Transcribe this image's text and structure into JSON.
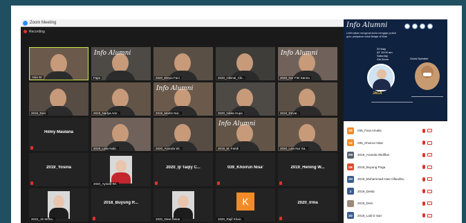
{
  "window": {
    "title": "Zoom Meeting",
    "recording_label": "Recording"
  },
  "tiles": [
    {
      "label": "Asia Sr",
      "kind": "video",
      "active": true
    },
    {
      "label": "Fajar",
      "kind": "video"
    },
    {
      "label": "2020_Eleyia Fani",
      "kind": "video"
    },
    {
      "label": "2020_Hikmal_Cle..",
      "kind": "video"
    },
    {
      "label": "2020_Nur Fitri Sanna",
      "kind": "video"
    },
    {
      "label": "2019_Desi",
      "kind": "video"
    },
    {
      "label": "2019_Nadya Amr..",
      "kind": "video"
    },
    {
      "label": "2019_Martin Nur..",
      "kind": "video"
    },
    {
      "label": "2020_Nikita Hupa",
      "kind": "video"
    },
    {
      "label": "2019_Dtrvar..",
      "kind": "video"
    },
    {
      "label": "Hilmy Maulana",
      "kind": "name"
    },
    {
      "label": "2019_Laila Nabi..",
      "kind": "video"
    },
    {
      "label": "2020_Ananda Wi..",
      "kind": "video"
    },
    {
      "label": "2019_M..Faridi",
      "kind": "video"
    },
    {
      "label": "2020_Lala Nur Sa..",
      "kind": "video"
    },
    {
      "label": "2019_Yosina",
      "kind": "name"
    },
    {
      "label": "2020_Ayinda Wi..",
      "kind": "photo"
    },
    {
      "label": "2020_Ijl Taqly C...",
      "kind": "name"
    },
    {
      "label": "039_Khoirun Nisa'",
      "kind": "name"
    },
    {
      "label": "2019_Hening W...",
      "kind": "name"
    },
    {
      "label": "2019_Jin Moha..",
      "kind": "photo"
    },
    {
      "label": "2018_Buyung R...",
      "kind": "name"
    },
    {
      "label": "2020_Dewi Sekar",
      "kind": "photo"
    },
    {
      "label": "2020_Rajif Khair..",
      "kind": "letter",
      "letter": "K"
    },
    {
      "label": "2020_Irma",
      "kind": "name"
    }
  ],
  "poster": {
    "title": "Info Alumni",
    "description": "Lebih dalam mengenal dunia mengajar profesi guru: pelayanan untuk Belajar di Kitab",
    "date": "29 May",
    "time": "AT 10:00 am",
    "day": "Saturday",
    "platform": "Via Zoom",
    "guest_label": "Guest Speaker",
    "logo_text": "JACA"
  },
  "participants": [
    {
      "initials": "03",
      "name": "035_Fara Amalia",
      "color": "#f28c28"
    },
    {
      "initials": "03",
      "name": "035_Khoirun Nisa'",
      "color": "#f28c28"
    },
    {
      "initials": "2W",
      "name": "2019_Ananda Widiflas",
      "color": "#555f6d"
    },
    {
      "initials": "2B",
      "name": "2018_Buyung Poga",
      "color": "#e0482f"
    },
    {
      "initials": "2H",
      "name": "2019_Muhammad Hasi Alfandha..",
      "color": "#3b5b8c"
    },
    {
      "initials": "2",
      "name": "2019_Desla",
      "color": "#3b5b8c"
    },
    {
      "initials": "",
      "name": "2019_Desi",
      "color": "#9b8a7a"
    },
    {
      "initials": "2D",
      "name": "2019_Laili D Sari",
      "color": "#3b5b8c"
    }
  ]
}
